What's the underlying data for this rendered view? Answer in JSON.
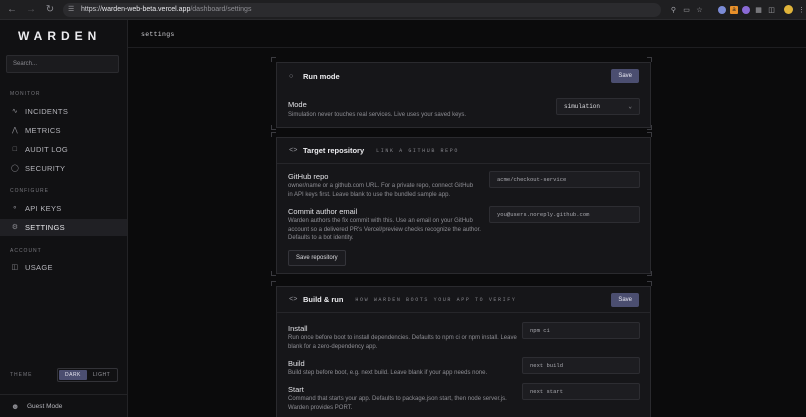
{
  "browser": {
    "url_prefix": "https://",
    "url_host": "warden-web-beta.vercel.app",
    "url_path": "/dashboard/settings"
  },
  "sidebar": {
    "logo": "WARDEN",
    "search_placeholder": "Search...",
    "sections": [
      {
        "label": "MONITOR"
      },
      {
        "label": "CONFIGURE"
      },
      {
        "label": "ACCOUNT"
      }
    ],
    "items": [
      {
        "label": "INCIDENTS",
        "icon": "activity-icon"
      },
      {
        "label": "METRICS",
        "icon": "chart-icon"
      },
      {
        "label": "AUDIT LOG",
        "icon": "document-icon"
      },
      {
        "label": "SECURITY",
        "icon": "shield-icon"
      },
      {
        "label": "API KEYS",
        "icon": "key-icon"
      },
      {
        "label": "SETTINGS",
        "icon": "gear-icon",
        "active": true
      },
      {
        "label": "USAGE",
        "icon": "layers-icon"
      }
    ],
    "theme": {
      "label": "THEME",
      "dark": "DARK",
      "light": "LIGHT",
      "selected": "DARK"
    },
    "user": "Guest Mode"
  },
  "topbar": {
    "title": "settings"
  },
  "run_mode": {
    "title": "Run mode",
    "save": "Save",
    "field_title": "Mode",
    "field_help": "Simulation never touches real services. Live uses your saved keys.",
    "value": "simulation"
  },
  "target_repo": {
    "title": "Target repository",
    "subtitle": "LINK A GITHUB REPO",
    "repo_title": "GitHub repo",
    "repo_help": "owner/name or a github.com URL. For a private repo, connect GitHub in API keys first. Leave blank to use the bundled sample app.",
    "repo_placeholder": "acme/checkout-service",
    "email_title": "Commit author email",
    "email_help": "Warden authors the fix commit with this. Use an email on your GitHub account so a delivered PR's Vercel/preview checks recognize the author. Defaults to a bot identity.",
    "email_placeholder": "you@users.noreply.github.com",
    "save_button": "Save repository"
  },
  "build_run": {
    "title": "Build & run",
    "subtitle": "HOW WARDEN BOOTS YOUR APP TO VERIFY",
    "save": "Save",
    "install_title": "Install",
    "install_help": "Run once before boot to install dependencies. Defaults to npm ci or npm install. Leave blank for a zero-dependency app.",
    "install_placeholder": "npm ci",
    "build_title": "Build",
    "build_help": "Build step before boot, e.g. next build. Leave blank if your app needs none.",
    "build_placeholder": "next build",
    "start_title": "Start",
    "start_help": "Command that starts your app. Defaults to package.json start, then node server.js. Warden provides PORT.",
    "start_placeholder": "next start"
  }
}
